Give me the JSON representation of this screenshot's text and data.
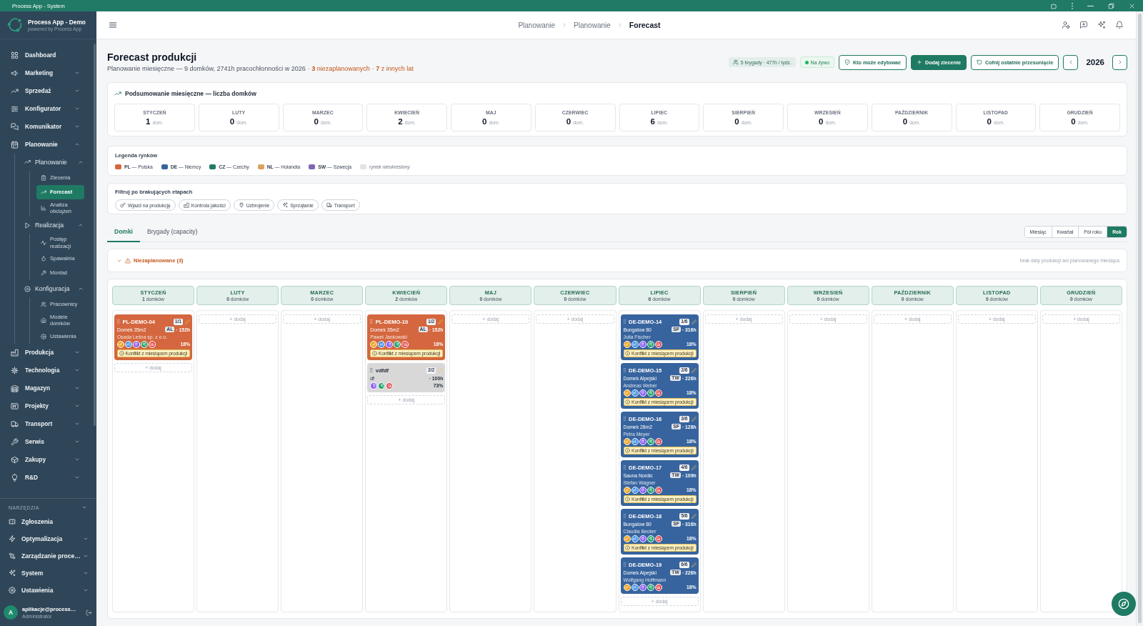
{
  "window": {
    "title": "Process App - System"
  },
  "sidebar": {
    "app_name": "Process App - Demo",
    "app_tagline": "powered by Process App",
    "items": [
      {
        "label": "Dashboard",
        "kind": "dashboard",
        "selected": false
      },
      {
        "label": "Marketing",
        "kind": "marketing",
        "selected": false,
        "expanded": false
      },
      {
        "label": "Sprzedaż",
        "kind": "sales",
        "selected": false,
        "expanded": false
      },
      {
        "label": "Konfigurator",
        "kind": "configurator",
        "selected": false,
        "expanded": false
      },
      {
        "label": "Komunikator",
        "kind": "messenger",
        "selected": false,
        "expanded": false
      },
      {
        "label": "Planowanie",
        "kind": "planning",
        "selected": false,
        "expanded": true,
        "children": [
          {
            "label": "Planowanie",
            "kind": "plans",
            "selected": false,
            "expanded": true,
            "children": [
              {
                "label": "Zlecenia",
                "kind": "orders",
                "selected": false
              },
              {
                "label": "Forecast",
                "kind": "forecast",
                "selected": true
              },
              {
                "label": "Analiza obciążeń",
                "kind": "load",
                "selected": false
              }
            ]
          },
          {
            "label": "Realizacja",
            "kind": "execution",
            "selected": false,
            "expanded": true,
            "children": [
              {
                "label": "Postęp realizacji",
                "kind": "progress",
                "selected": false
              },
              {
                "label": "Spawalnia",
                "kind": "welding",
                "selected": false
              },
              {
                "label": "Montaż",
                "kind": "assembly",
                "selected": false
              }
            ]
          },
          {
            "label": "Konfiguracja",
            "kind": "configuration",
            "selected": false,
            "expanded": true,
            "children": [
              {
                "label": "Pracownicy",
                "kind": "workers",
                "selected": false
              },
              {
                "label": "Modele domków",
                "kind": "models",
                "selected": false
              },
              {
                "label": "Ustawienia",
                "kind": "settings",
                "selected": false
              }
            ]
          }
        ]
      },
      {
        "label": "Produkcja",
        "kind": "production",
        "selected": false,
        "expanded": false
      },
      {
        "label": "Technologia",
        "kind": "technology",
        "selected": false,
        "expanded": false
      },
      {
        "label": "Magazyn",
        "kind": "warehouse",
        "selected": false,
        "expanded": false
      },
      {
        "label": "Projekty",
        "kind": "projects",
        "selected": false,
        "expanded": false
      },
      {
        "label": "Transport",
        "kind": "transport",
        "selected": false,
        "expanded": false
      },
      {
        "label": "Serwis",
        "kind": "service",
        "selected": false,
        "expanded": false
      },
      {
        "label": "Zakupy",
        "kind": "purchasing",
        "selected": false,
        "expanded": false
      },
      {
        "label": "R&D",
        "kind": "research",
        "selected": false,
        "expanded": false
      }
    ],
    "tools": {
      "heading": "NARZĘDZIA",
      "expanded": true,
      "items": [
        {
          "label": "Zgłoszenia",
          "kind": "tickets",
          "selected": false
        },
        {
          "label": "Optymalizacja",
          "kind": "optimization",
          "selected": false,
          "expanded": false
        },
        {
          "label": "Zarządzanie proce…",
          "kind": "processes",
          "selected": false,
          "expanded": false
        },
        {
          "label": "System",
          "kind": "system",
          "selected": false,
          "expanded": false
        },
        {
          "label": "Ustawienia",
          "kind": "settings",
          "selected": false,
          "expanded": false
        }
      ]
    },
    "user": {
      "initial": "A",
      "name": "aplikacje@process…",
      "role": "Administrator"
    }
  },
  "topbar": {
    "breadcrumbs": [
      {
        "label": "Planowanie",
        "selected": false
      },
      {
        "label": "Planowanie",
        "selected": false
      },
      {
        "label": "Forecast",
        "selected": true
      }
    ]
  },
  "page": {
    "title": "Forecast produkcji",
    "subtitle": "Planowanie miesięczne — 9 domków, 2741h pracochłonności w 2026",
    "alerts": [
      "· **3** niezaplanowanych",
      "· **7** z innych lat"
    ],
    "capacity": "5 brygady · 477h / tydz.",
    "live": {
      "label": "Na żywo",
      "on": true
    },
    "actions": [
      {
        "label": "Kto może edytować",
        "kind": "permissions",
        "primary": false
      },
      {
        "label": "Dodaj zlecenie",
        "kind": "add",
        "primary": true
      },
      {
        "label": "Cofnij ostatnie przesunięcie",
        "kind": "undo",
        "primary": false
      }
    ],
    "year": "2026"
  },
  "summary": {
    "title": "Podsumowanie miesięczne — liczba domków",
    "months": [
      {
        "name": "STYCZEŃ",
        "count": "1",
        "unit": "dom."
      },
      {
        "name": "LUTY",
        "count": "0",
        "unit": "dom."
      },
      {
        "name": "MARZEC",
        "count": "0",
        "unit": "dom."
      },
      {
        "name": "KWIECIEŃ",
        "count": "2",
        "unit": "dom."
      },
      {
        "name": "MAJ",
        "count": "0",
        "unit": "dom."
      },
      {
        "name": "CZERWIEC",
        "count": "0",
        "unit": "dom."
      },
      {
        "name": "LIPIEC",
        "count": "6",
        "unit": "dom."
      },
      {
        "name": "SIERPIEŃ",
        "count": "0",
        "unit": "dom."
      },
      {
        "name": "WRZESIEŃ",
        "count": "0",
        "unit": "dom."
      },
      {
        "name": "PAŹDZIERNIK",
        "count": "0",
        "unit": "dom."
      },
      {
        "name": "LISTOPAD",
        "count": "0",
        "unit": "dom."
      },
      {
        "name": "GRUDZIEŃ",
        "count": "0",
        "unit": "dom."
      }
    ]
  },
  "legend": {
    "title": "Legenda rynków",
    "items": [
      {
        "label": "**PL** — Polska",
        "kind": "market",
        "color": "#d4673f"
      },
      {
        "label": "**DE** — Niemcy",
        "kind": "market",
        "color": "#37649e"
      },
      {
        "label": "**CZ** — Czechy",
        "kind": "market",
        "color": "#1f7a63"
      },
      {
        "label": "**NL** — Holandia",
        "kind": "market",
        "color": "#dba35d"
      },
      {
        "label": "**SW** — Szwecja",
        "kind": "market",
        "color": "#7d67b3"
      },
      {
        "label": "rynek nieokreślony",
        "kind": "unassigned",
        "color": "#e3e3e3"
      }
    ]
  },
  "filters": {
    "title": "Filtruj po brakujących etapach",
    "chips": [
      {
        "label": "Wjazd na produkcję",
        "kind": "entry",
        "selected": false
      },
      {
        "label": "Kontrola jakości",
        "kind": "quality",
        "selected": false
      },
      {
        "label": "Uzbrojenie",
        "kind": "wiring",
        "selected": false
      },
      {
        "label": "Sprzątanie",
        "kind": "cleaning",
        "selected": false
      },
      {
        "label": "Transport",
        "kind": "transport",
        "selected": false
      }
    ]
  },
  "tabs": [
    {
      "label": "Domki",
      "selected": true
    },
    {
      "label": "Brygady (capacity)",
      "selected": false
    }
  ],
  "ranges": [
    {
      "label": "Miesiąc",
      "selected": false
    },
    {
      "label": "Kwartał",
      "selected": false
    },
    {
      "label": "Pół roku",
      "selected": false
    },
    {
      "label": "Rok",
      "selected": true
    }
  ],
  "unplanned": {
    "label": "Niezaplanowane (3)",
    "expanded": false,
    "note": "brak daty produkcji ani planowanego miesiąca"
  },
  "board": {
    "columns": [
      {
        "name": "STYCZEŃ",
        "count": "**1** domków",
        "add_label": "+ dodaj",
        "cards": [
          {
            "code": "PL-DEMO-04",
            "position": "1/1",
            "model": "Domek 35m2",
            "tag": "AL",
            "hours": "· 152h",
            "client": "Osada Leśna sp. z o.o.",
            "color": "#d4673f",
            "stages": [
              {
                "kind": "entry"
              },
              {
                "kind": "quality"
              },
              {
                "kind": "wiring"
              },
              {
                "kind": "cleaning"
              },
              {
                "kind": "transport"
              }
            ],
            "progress": "18%",
            "warning": "Konflikt z miesiącem produkcji"
          }
        ]
      },
      {
        "name": "LUTY",
        "count": "**0** domków",
        "add_label": "+ dodaj"
      },
      {
        "name": "MARZEC",
        "count": "**0** domków",
        "add_label": "+ dodaj"
      },
      {
        "name": "KWIECIEŃ",
        "count": "**2** domków",
        "add_label": "+ dodaj",
        "cards": [
          {
            "code": "PL-DEMO-10",
            "position": "1/2",
            "model": "Domek 35m2",
            "tag": "AL",
            "hours": "· 152h",
            "client": "Paweł Jankowski",
            "color": "#d4673f",
            "stages": [
              {
                "kind": "entry"
              },
              {
                "kind": "quality"
              },
              {
                "kind": "wiring"
              },
              {
                "kind": "cleaning"
              },
              {
                "kind": "transport"
              }
            ],
            "progress": "18%",
            "warning": "Konflikt z miesiącem produkcji"
          },
          {
            "code": "vdfdf",
            "position": "2/2",
            "model": "df",
            "hours": "· 100h",
            "color": "#d8d8d8",
            "stages": [
              {
                "kind": "wiring"
              },
              {
                "kind": "cleaning"
              },
              {
                "kind": "transport"
              }
            ],
            "progress": "73%"
          }
        ]
      },
      {
        "name": "MAJ",
        "count": "**0** domków",
        "add_label": "+ dodaj"
      },
      {
        "name": "CZERWIEC",
        "count": "**0** domków",
        "add_label": "+ dodaj"
      },
      {
        "name": "LIPIEC",
        "count": "**6** domków",
        "add_label": "+ dodaj",
        "cards": [
          {
            "code": "DE-DEMO-14",
            "position": "1/6",
            "model": "Bungalow 80",
            "tag": "SF",
            "hours": "· 316h",
            "client": "Julia Fischer",
            "color": "#37649e",
            "stages": [
              {
                "kind": "entry"
              },
              {
                "kind": "quality"
              },
              {
                "kind": "wiring"
              },
              {
                "kind": "cleaning"
              },
              {
                "kind": "transport"
              }
            ],
            "progress": "18%",
            "warning": "Konflikt z miesiącem produkcji"
          },
          {
            "code": "DE-DEMO-15",
            "position": "2/6",
            "model": "Domek Alpejski",
            "tag": "TW",
            "hours": "· 226h",
            "client": "Andreas Weber",
            "color": "#37649e",
            "stages": [
              {
                "kind": "entry"
              },
              {
                "kind": "quality"
              },
              {
                "kind": "wiring"
              },
              {
                "kind": "cleaning"
              },
              {
                "kind": "transport"
              }
            ],
            "progress": "18%",
            "warning": "Konflikt z miesiącem produkcji"
          },
          {
            "code": "DE-DEMO-16",
            "position": "3/6",
            "model": "Domek 28m2",
            "tag": "SF",
            "hours": "· 128h",
            "client": "Petra Meyer",
            "color": "#37649e",
            "stages": [
              {
                "kind": "entry"
              },
              {
                "kind": "quality"
              },
              {
                "kind": "wiring"
              },
              {
                "kind": "cleaning"
              },
              {
                "kind": "transport"
              }
            ],
            "progress": "18%",
            "warning": "Konflikt z miesiącem produkcji"
          },
          {
            "code": "DE-DEMO-17",
            "position": "4/6",
            "model": "Sauna Nordic",
            "tag": "TW",
            "hours": "· 109h",
            "client": "Stefan Wagner",
            "color": "#37649e",
            "stages": [
              {
                "kind": "entry"
              },
              {
                "kind": "quality"
              },
              {
                "kind": "wiring"
              },
              {
                "kind": "cleaning"
              },
              {
                "kind": "transport"
              }
            ],
            "progress": "18%",
            "warning": "Konflikt z miesiącem produkcji"
          },
          {
            "code": "DE-DEMO-18",
            "position": "5/6",
            "model": "Bungalow 80",
            "tag": "SF",
            "hours": "· 316h",
            "client": "Claudia Becker",
            "color": "#37649e",
            "stages": [
              {
                "kind": "entry"
              },
              {
                "kind": "quality"
              },
              {
                "kind": "wiring"
              },
              {
                "kind": "cleaning"
              },
              {
                "kind": "transport"
              }
            ],
            "progress": "18%",
            "warning": "Konflikt z miesiącem produkcji"
          },
          {
            "code": "DE-DEMO-19",
            "position": "6/6",
            "model": "Domek Alpejski",
            "tag": "TW",
            "hours": "· 226h",
            "client": "Wolfgang Hoffmann",
            "color": "#37649e",
            "stages": [
              {
                "kind": "entry"
              },
              {
                "kind": "quality"
              },
              {
                "kind": "wiring"
              },
              {
                "kind": "cleaning"
              },
              {
                "kind": "transport"
              }
            ],
            "progress": "18%"
          }
        ]
      },
      {
        "name": "SIERPIEŃ",
        "count": "**0** domków",
        "add_label": "+ dodaj"
      },
      {
        "name": "WRZESIEŃ",
        "count": "**0** domków",
        "add_label": "+ dodaj"
      },
      {
        "name": "PAŹDZIERNIK",
        "count": "**0** domków",
        "add_label": "+ dodaj"
      },
      {
        "name": "LISTOPAD",
        "count": "**0** domków",
        "add_label": "+ dodaj"
      },
      {
        "name": "GRUDZIEŃ",
        "count": "**0** domków",
        "add_label": "+ dodaj"
      }
    ]
  }
}
